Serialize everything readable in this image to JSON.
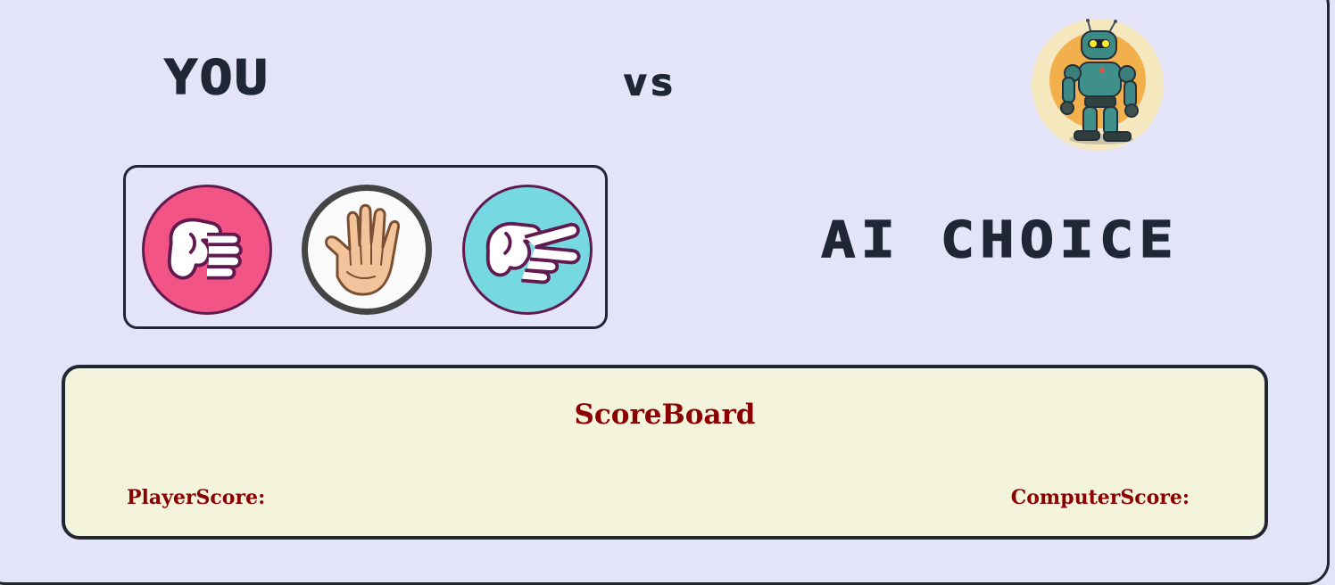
{
  "header": {
    "you_label": "YOU",
    "vs_label": "vs"
  },
  "ai": {
    "choice_label": "AI CHOICE",
    "avatar_icon": "robot-avatar-icon"
  },
  "choices": [
    {
      "name": "rock",
      "icon": "rock-fist-icon",
      "color": "#f25486"
    },
    {
      "name": "paper",
      "icon": "paper-hand-icon",
      "color": "#ffffff"
    },
    {
      "name": "scissors",
      "icon": "scissors-hand-icon",
      "color": "#76d8e1"
    }
  ],
  "scoreboard": {
    "title": "ScoreBoard",
    "player_label": "PlayerScore:",
    "computer_label": "ComputerScore:"
  },
  "colors": {
    "page_background": "#e4e4f8",
    "scoreboard_background": "#f4f4dc",
    "score_text": "#8b0000",
    "title_text": "#1f2635"
  }
}
